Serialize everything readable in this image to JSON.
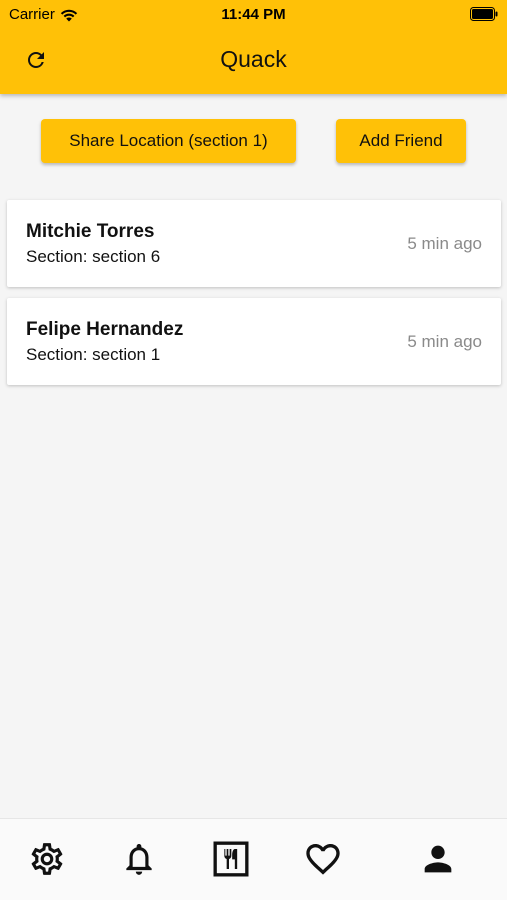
{
  "status_bar": {
    "carrier": "Carrier",
    "time": "11:44 PM"
  },
  "app_bar": {
    "title": "Quack",
    "refresh_icon": "refresh-icon",
    "background_color": "#ffc107"
  },
  "actions": {
    "share_location_label": "Share Location (section 1)",
    "add_friend_label": "Add Friend"
  },
  "friends": [
    {
      "name": "Mitchie Torres",
      "section": "Section: section 6",
      "time": "5 min ago"
    },
    {
      "name": "Felipe Hernandez",
      "section": "Section: section 1",
      "time": "5 min ago"
    }
  ],
  "bottom_nav": {
    "items": [
      {
        "icon": "gear-icon"
      },
      {
        "icon": "bell-icon"
      },
      {
        "icon": "restaurant-icon"
      },
      {
        "icon": "heart-icon"
      },
      {
        "icon": "person-icon"
      }
    ]
  }
}
